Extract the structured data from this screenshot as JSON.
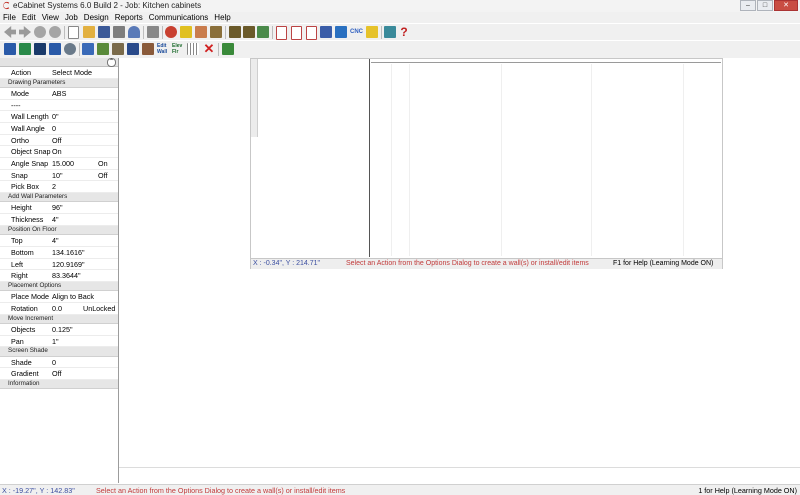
{
  "window": {
    "title": "eCabinet Systems 6.0 Build 2 - Job: Kitchen cabinets"
  },
  "menu": [
    "File",
    "Edit",
    "View",
    "Job",
    "Design",
    "Reports",
    "Communications",
    "Help"
  ],
  "properties": {
    "action": {
      "label": "Action",
      "value": "Select Mode"
    },
    "drawing_parameters": {
      "header": "Drawing Parameters",
      "rows": [
        {
          "label": "Mode",
          "value": "ABS",
          "extra": ""
        },
        {
          "label": "----",
          "value": "",
          "extra": ""
        },
        {
          "label": "Wall Length",
          "value": "0\"",
          "extra": ""
        },
        {
          "label": "Wall Angle",
          "value": "0",
          "extra": ""
        },
        {
          "label": "Ortho",
          "value": "Off",
          "extra": ""
        },
        {
          "label": "Object Snap",
          "value": "On",
          "extra": ""
        },
        {
          "label": "Angle Snap",
          "value": "15.000",
          "extra": "On"
        },
        {
          "label": "Snap",
          "value": "10\"",
          "extra": "Off"
        },
        {
          "label": "Pick Box",
          "value": "2",
          "extra": ""
        }
      ]
    },
    "add_wall_parameters": {
      "header": "Add Wall Parameters",
      "rows": [
        {
          "label": "Height",
          "value": "96\""
        },
        {
          "label": "Thickness",
          "value": "4\""
        }
      ]
    },
    "position_on_floor": {
      "header": "Position On Floor",
      "rows": [
        {
          "label": "Top",
          "value": "4\""
        },
        {
          "label": "Bottom",
          "value": "134.1616\""
        },
        {
          "label": "Left",
          "value": "120.9169\""
        },
        {
          "label": "Right",
          "value": "83.3644\""
        }
      ]
    },
    "placement_options": {
      "header": "Placement Options",
      "rows": [
        {
          "label": "Place Mode",
          "value": "Align to Back",
          "extra": ""
        },
        {
          "label": "Rotation",
          "value": "0.0",
          "extra": "UnLocked"
        }
      ]
    },
    "move_increment": {
      "header": "Move Increment",
      "rows": [
        {
          "label": "Objects",
          "value": "0.125\""
        },
        {
          "label": "Pan",
          "value": "1\""
        }
      ]
    },
    "screen_shade": {
      "header": "Screen Shade",
      "rows": [
        {
          "label": "Shade",
          "value": "0"
        },
        {
          "label": "Gradient",
          "value": "Off"
        }
      ]
    },
    "information": {
      "header": "Information"
    }
  },
  "drawing_view": {
    "coords": "X : -0.34\", Y : 214.71\"",
    "message": "Select an Action from the Options Dialog to create a wall(s) or install/edit items",
    "help": "F1 for Help (Learning Mode ON)"
  },
  "status": {
    "coords": "X : -19.27\", Y : 142.83\"",
    "message": "Select an Action from the Options Dialog to create a wall(s) or install/edit items",
    "help": "1 for Help (Learning Mode ON)"
  },
  "colors": {
    "accent_red": "#c13a3a",
    "coord_blue": "#3b4ea0"
  }
}
